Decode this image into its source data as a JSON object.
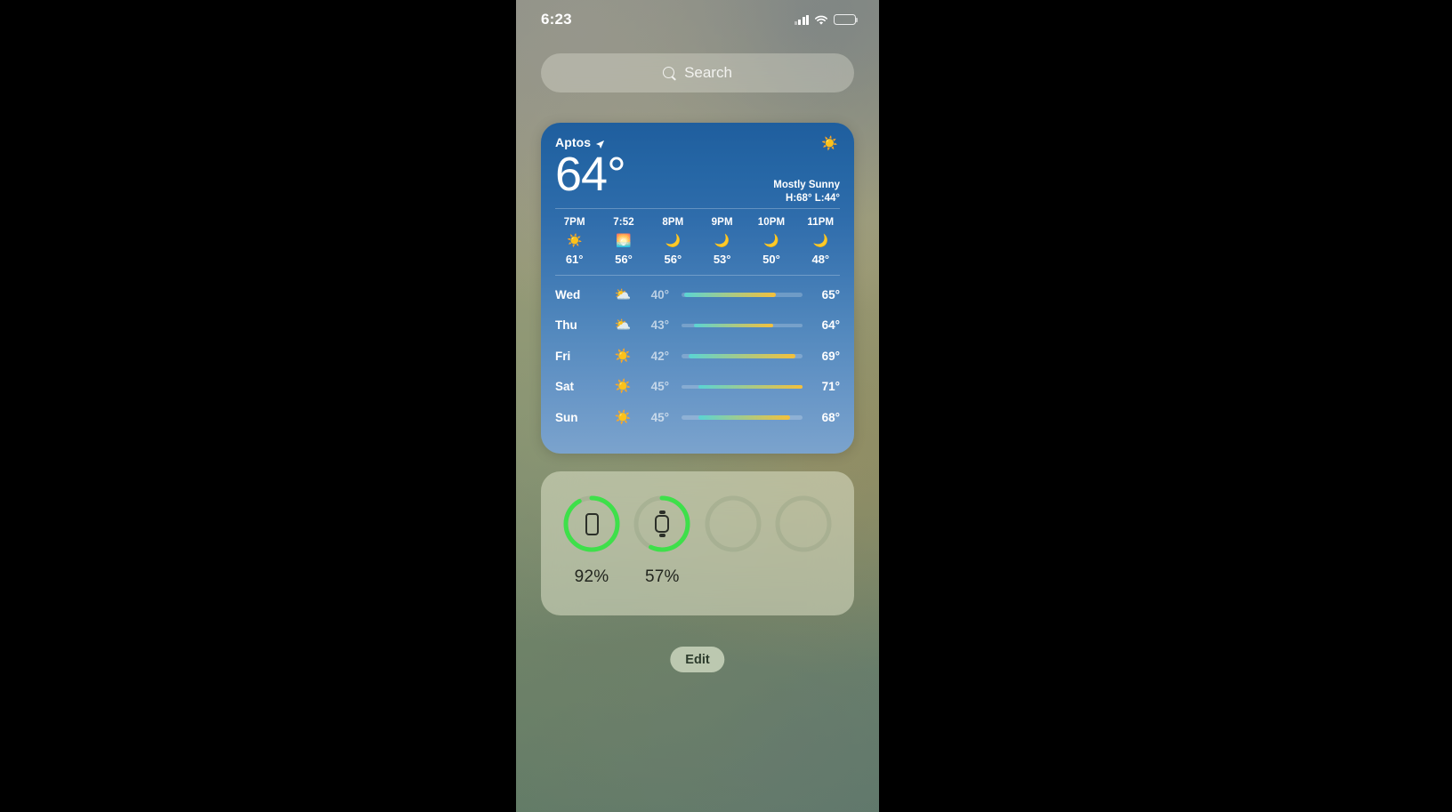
{
  "status_bar": {
    "time": "6:23",
    "cellular_icon": "cellular-signal-icon",
    "wifi_icon": "wifi-icon",
    "battery_icon": "battery-icon"
  },
  "search": {
    "placeholder": "Search",
    "icon": "search-icon"
  },
  "weather_widget": {
    "location": "Aptos",
    "location_icon": "location-arrow-icon",
    "current_temp": "64°",
    "condition": "Mostly Sunny",
    "high_low": "H:68° L:44°",
    "condition_icon": "sun-icon",
    "hourly": [
      {
        "time": "7PM",
        "icon": "sun-icon",
        "glyph": "☀",
        "temp": "61°"
      },
      {
        "time": "7:52",
        "icon": "sunset-icon",
        "glyph": "☀",
        "temp": "56°"
      },
      {
        "time": "8PM",
        "icon": "moon-icon",
        "glyph": "☾",
        "temp": "56°"
      },
      {
        "time": "9PM",
        "icon": "moon-icon",
        "glyph": "☾",
        "temp": "53°"
      },
      {
        "time": "10PM",
        "icon": "moon-icon",
        "glyph": "☾",
        "temp": "50°"
      },
      {
        "time": "11PM",
        "icon": "moon-icon",
        "glyph": "☾",
        "temp": "48°"
      }
    ],
    "daily": [
      {
        "day": "Wed",
        "icon": "partly-cloudy-icon",
        "glyph": "⛅",
        "low": "40°",
        "high": "65°",
        "bar_start": 2,
        "bar_end": 78
      },
      {
        "day": "Thu",
        "icon": "partly-cloudy-icon",
        "glyph": "⛅",
        "low": "43°",
        "high": "64°",
        "bar_start": 10,
        "bar_end": 76
      },
      {
        "day": "Fri",
        "icon": "sun-icon",
        "glyph": "☀",
        "low": "42°",
        "high": "69°",
        "bar_start": 6,
        "bar_end": 94
      },
      {
        "day": "Sat",
        "icon": "sun-icon",
        "glyph": "☀",
        "low": "45°",
        "high": "71°",
        "bar_start": 14,
        "bar_end": 100
      },
      {
        "day": "Sun",
        "icon": "sun-icon",
        "glyph": "☀",
        "low": "45°",
        "high": "68°",
        "bar_start": 14,
        "bar_end": 90
      }
    ],
    "colors": {
      "bar_low": "#5ad4d4",
      "bar_high": "#f5c03a",
      "widget_top": "#1f5e9e",
      "widget_bottom": "#7ba3cd"
    }
  },
  "batteries_widget": {
    "ring_color": "#3ee04a",
    "ring_track_color": "rgba(120,140,110,0.22)",
    "items": [
      {
        "device": "iphone",
        "device_icon": "iphone-icon",
        "percent": "92%",
        "value": 92
      },
      {
        "device": "watch",
        "device_icon": "apple-watch-icon",
        "percent": "57%",
        "value": 57
      },
      {
        "device": "empty",
        "device_icon": "empty-slot-icon",
        "percent": "",
        "value": 0
      },
      {
        "device": "empty",
        "device_icon": "empty-slot-icon",
        "percent": "",
        "value": 0
      }
    ]
  },
  "edit_button": {
    "label": "Edit"
  }
}
